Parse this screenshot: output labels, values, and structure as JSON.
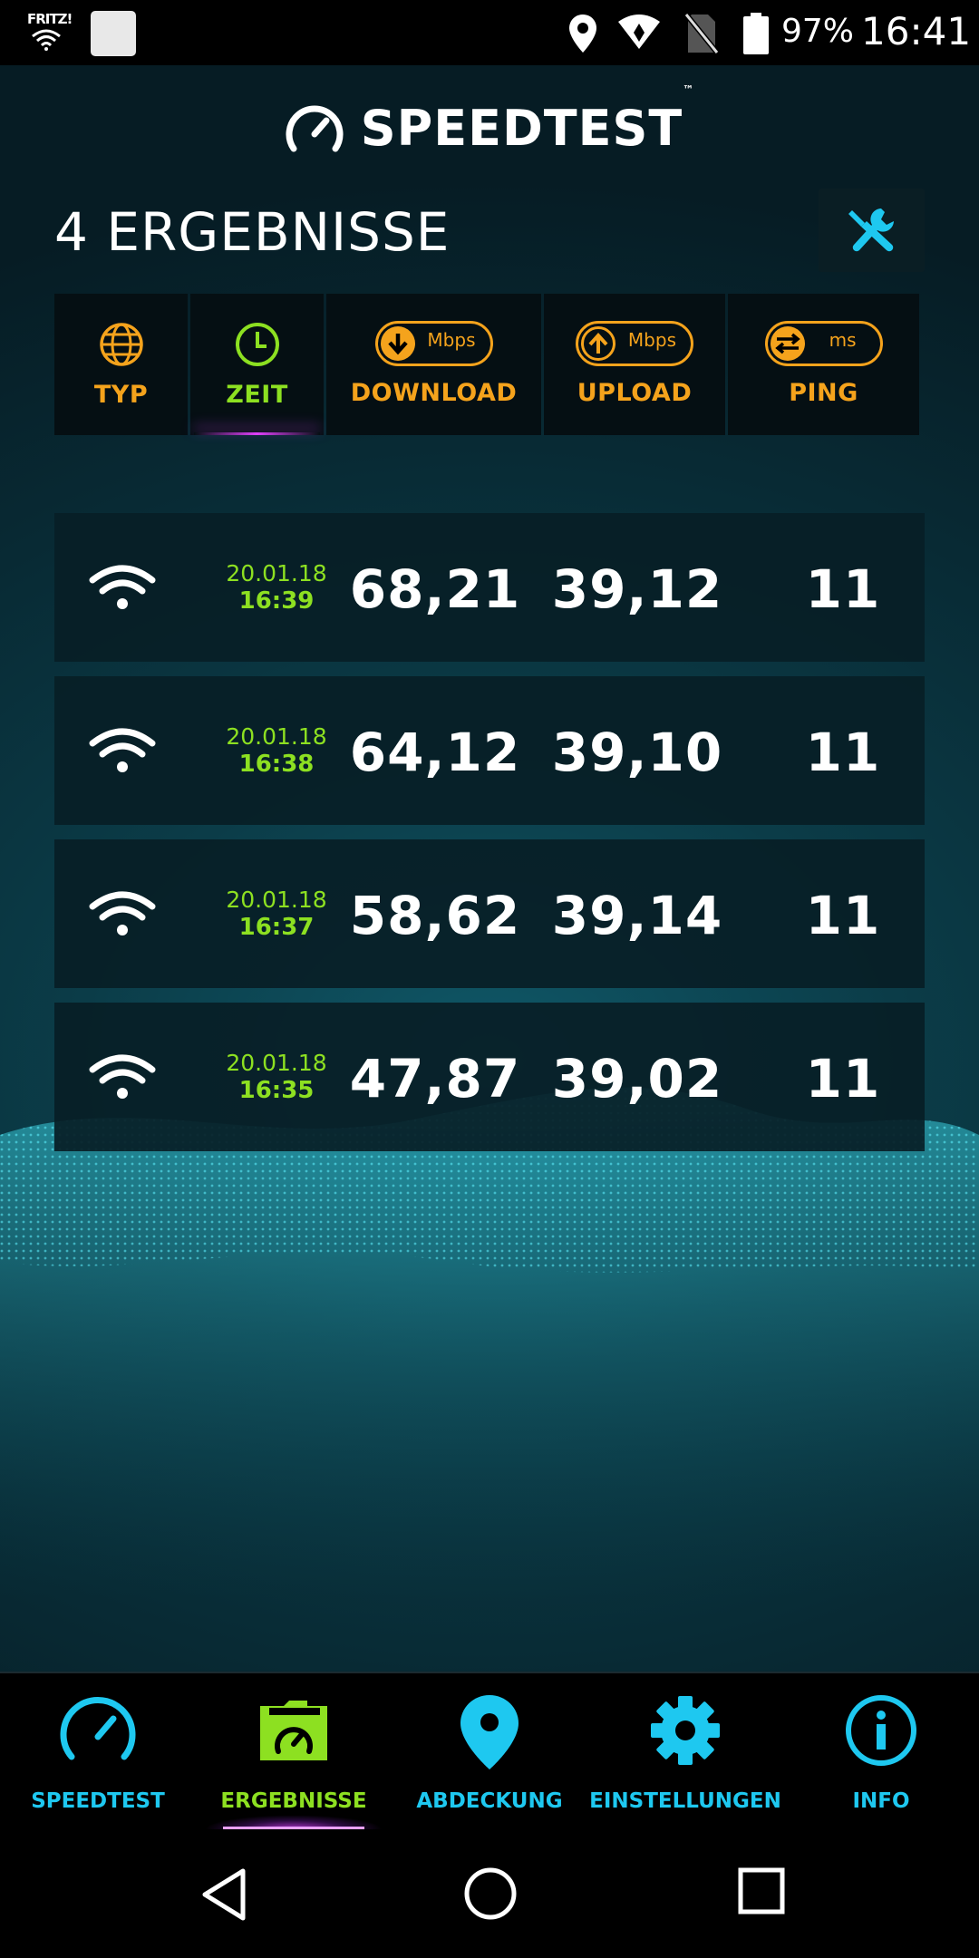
{
  "status_bar": {
    "carrier_logo": "FRITZ!",
    "battery_percent": "97%",
    "time": "16:41",
    "icons": [
      "wifi-icon",
      "notification-square-icon",
      "location-icon",
      "wifi-signal-icon",
      "no-sim-icon",
      "battery-icon"
    ]
  },
  "header": {
    "brand": "SPEEDTEST",
    "trademark": "™",
    "results_count": "4 ERGEBNISSE",
    "tools_icon": "tools-icon"
  },
  "columns": [
    {
      "label": "TYP",
      "icon": "globe-icon",
      "active": false
    },
    {
      "label": "ZEIT",
      "icon": "clock-icon",
      "active": true
    },
    {
      "label": "DOWNLOAD",
      "icon": "download-arrow-icon",
      "unit": "Mbps",
      "active": false
    },
    {
      "label": "UPLOAD",
      "icon": "upload-arrow-icon",
      "unit": "Mbps",
      "active": false
    },
    {
      "label": "PING",
      "icon": "ping-arrows-icon",
      "unit": "ms",
      "active": false
    }
  ],
  "results": [
    {
      "type": "wifi",
      "date": "20.01.18",
      "time": "16:39",
      "download": "68,21",
      "upload": "39,12",
      "ping": "11"
    },
    {
      "type": "wifi",
      "date": "20.01.18",
      "time": "16:38",
      "download": "64,12",
      "upload": "39,10",
      "ping": "11"
    },
    {
      "type": "wifi",
      "date": "20.01.18",
      "time": "16:37",
      "download": "58,62",
      "upload": "39,14",
      "ping": "11"
    },
    {
      "type": "wifi",
      "date": "20.01.18",
      "time": "16:35",
      "download": "47,87",
      "upload": "39,02",
      "ping": "11"
    }
  ],
  "bottom_nav": [
    {
      "label": "SPEEDTEST",
      "icon": "speedometer-icon",
      "active": false
    },
    {
      "label": "ERGEBNISSE",
      "icon": "results-folder-icon",
      "active": true
    },
    {
      "label": "ABDECKUNG",
      "icon": "map-pin-icon",
      "active": false
    },
    {
      "label": "EINSTELLUNGEN",
      "icon": "gear-icon",
      "active": false
    },
    {
      "label": "INFO",
      "icon": "info-icon",
      "active": false
    }
  ],
  "colors": {
    "accent_orange": "#f5a31c",
    "accent_green": "#8de021",
    "accent_cyan": "#1ec8f0",
    "accent_purple": "#e040fb"
  }
}
